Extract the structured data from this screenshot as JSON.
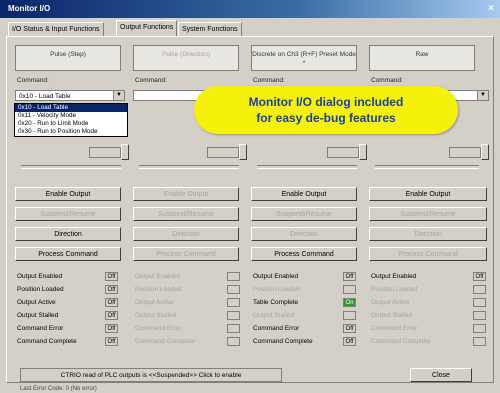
{
  "window": {
    "title": "Monitor I/O",
    "close_glyph": "×"
  },
  "tabs": [
    {
      "label": "I/O Status & Input Functions"
    },
    {
      "label": "Output Functions"
    },
    {
      "label": "System Functions"
    }
  ],
  "columns": [
    {
      "header": "Pulse (Step)",
      "command_label": "Command:",
      "command_value": "0x10 - Load Table",
      "buttons": [
        "Enable Output",
        "Suspend/Resume",
        "Direction",
        "Process Command"
      ],
      "status": [
        {
          "label": "Output Enabled",
          "value": "Off"
        },
        {
          "label": "Position Loaded",
          "value": "Off"
        },
        {
          "label": "Output Active",
          "value": "Off"
        },
        {
          "label": "Output Stalled",
          "value": "Off"
        },
        {
          "label": "Command Error",
          "value": "Off"
        },
        {
          "label": "Command Complete",
          "value": "Off"
        }
      ]
    },
    {
      "header": "Pulse (Direction)",
      "command_label": "Command:",
      "command_value": "",
      "buttons": [
        "Enable Output",
        "Suspend/Resume",
        "Direction",
        "Process Command"
      ],
      "status": [
        {
          "label": "Output Enabled",
          "value": ""
        },
        {
          "label": "Position Loaded",
          "value": ""
        },
        {
          "label": "Output Active",
          "value": ""
        },
        {
          "label": "Output Stalled",
          "value": ""
        },
        {
          "label": "Command Error",
          "value": ""
        },
        {
          "label": "Command Complete",
          "value": ""
        }
      ]
    },
    {
      "header": "Discrete on Ch3 (R+F) Preset Mode *",
      "command_label": "Command:",
      "command_value": "",
      "buttons": [
        "Enable Output",
        "Suspend/Resume",
        "Direction",
        "Process Command"
      ],
      "status": [
        {
          "label": "Output Enabled",
          "value": "Off"
        },
        {
          "label": "Position Loaded",
          "value": ""
        },
        {
          "label": "Table Complete",
          "value": "On"
        },
        {
          "label": "Output Stalled",
          "value": ""
        },
        {
          "label": "Command Error",
          "value": "Off"
        },
        {
          "label": "Command Complete",
          "value": "Off"
        }
      ]
    },
    {
      "header": "Raw",
      "command_label": "Command:",
      "command_value": "",
      "buttons": [
        "Enable Output",
        "Suspend/Resume",
        "Direction",
        "Process Command"
      ],
      "status": [
        {
          "label": "Output Enabled",
          "value": "Off"
        },
        {
          "label": "Position Loaded",
          "value": ""
        },
        {
          "label": "Output Active",
          "value": ""
        },
        {
          "label": "Output Stalled",
          "value": ""
        },
        {
          "label": "Command Error",
          "value": ""
        },
        {
          "label": "Command Complete",
          "value": ""
        }
      ]
    }
  ],
  "dropdown_options": [
    "0x10 - Load Table",
    "0x11 - Velocity Mode",
    "0x20 - Run to Limit Mode",
    "0x30 - Run to Position Mode"
  ],
  "bottom": {
    "ctrio_text": "CTRIO read of PLC outputs is <<Suspended>> Click to enable",
    "close_label": "Close",
    "status_line": "Last Error Code: 0 (No error)"
  },
  "callout": {
    "line1": "Monitor I/O dialog included",
    "line2": "for easy de-bug features"
  },
  "colors": {
    "callout_bg": "#f5f10a",
    "callout_text": "#1a3fa6",
    "on_indicator": "#2f9a2f"
  }
}
